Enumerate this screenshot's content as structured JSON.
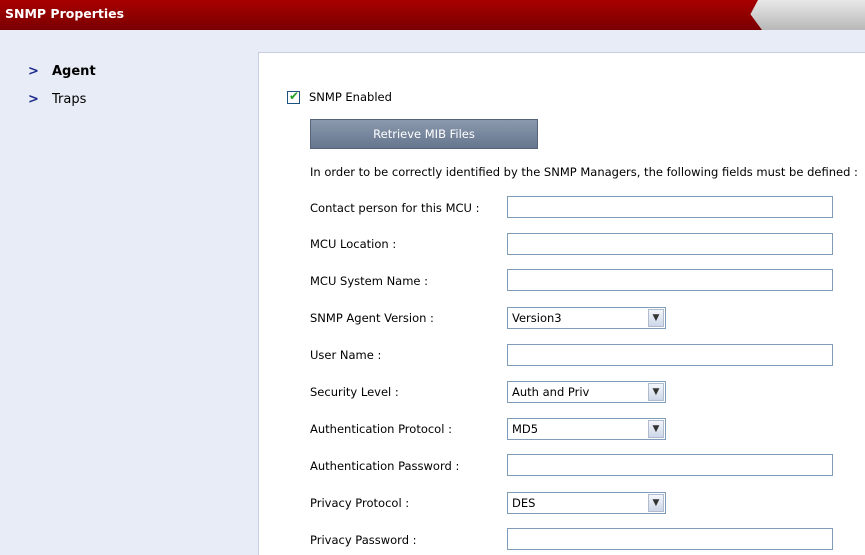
{
  "window": {
    "title": "SNMP Properties"
  },
  "nav": {
    "items": [
      {
        "label": "Agent",
        "active": true
      },
      {
        "label": "Traps",
        "active": false
      }
    ]
  },
  "agent": {
    "snmp_enabled_label": "SNMP Enabled",
    "snmp_enabled": true,
    "retrieve_button": "Retrieve MIB Files",
    "info_text": "In order to be correctly identified by the SNMP Managers, the following fields must be defined :",
    "fields": {
      "contact_person": {
        "label": "Contact person for this MCU :",
        "value": ""
      },
      "location": {
        "label": "MCU Location :",
        "value": ""
      },
      "system_name": {
        "label": "MCU System Name :",
        "value": ""
      },
      "agent_version": {
        "label": "SNMP Agent Version :",
        "value": "Version3"
      },
      "user_name": {
        "label": "User Name :",
        "value": ""
      },
      "security_level": {
        "label": "Security Level :",
        "value": "Auth and Priv"
      },
      "auth_protocol": {
        "label": "Authentication Protocol :",
        "value": "MD5"
      },
      "auth_password": {
        "label": "Authentication Password :",
        "value": ""
      },
      "privacy_protocol": {
        "label": "Privacy Protocol :",
        "value": "DES"
      },
      "privacy_password": {
        "label": "Privacy Password :",
        "value": ""
      }
    }
  }
}
